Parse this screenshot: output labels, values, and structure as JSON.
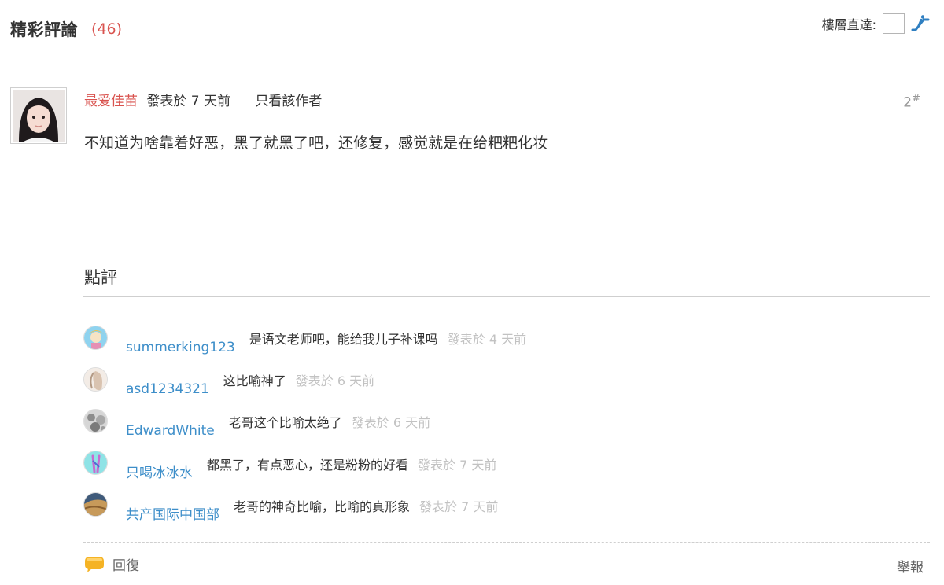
{
  "header": {
    "title": "精彩評論",
    "count": "(46)",
    "floor_jump_label": "樓層直達:",
    "floor_jump_value": ""
  },
  "post": {
    "author": "最爱佳苗",
    "posted": "發表於 7 天前",
    "only_author": "只看該作者",
    "floor_number": "2",
    "floor_mark": "#",
    "content": "不知道为啥靠着好恶，黑了就黑了吧，还修复，感觉就是在给粑粑化妆"
  },
  "rates": {
    "title": "點評",
    "items": [
      {
        "user": "summerking123",
        "text": "是语文老师吧，能给我儿子补课吗",
        "time": "發表於 4 天前"
      },
      {
        "user": "asd1234321",
        "text": "这比喻神了",
        "time": "發表於 6 天前"
      },
      {
        "user": "EdwardWhite",
        "text": "老哥这个比喻太绝了",
        "time": "發表於 6 天前"
      },
      {
        "user": "只喝冰冰水",
        "text": "都黑了，有点恶心，还是粉粉的好看",
        "time": "發表於 7 天前"
      },
      {
        "user": "共产国际中国部",
        "text": "老哥的神奇比喻，比喻的真形象",
        "time": "發表於 7 天前"
      }
    ]
  },
  "actions": {
    "reply": "回復",
    "report": "舉報"
  },
  "colors": {
    "author": "#d9534f",
    "username": "#3d8ec9",
    "muted": "#c2c2c2",
    "reply_icon": "#f5b324"
  }
}
